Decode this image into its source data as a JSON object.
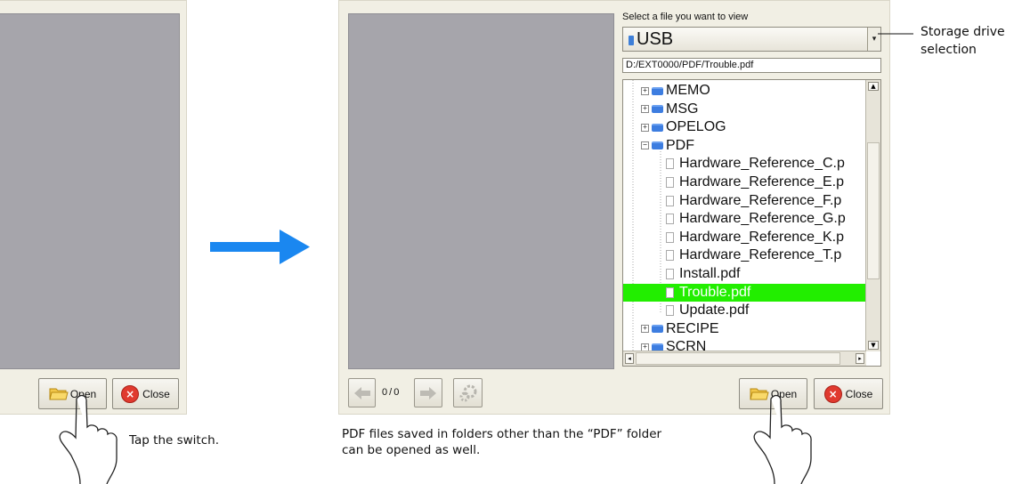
{
  "left_panel": {
    "open_label": "Open",
    "close_label": "Close",
    "caption": "Tap the switch."
  },
  "right_panel": {
    "heading": "Select a file you want to view",
    "drive": "USB",
    "path": "D:/EXT0000/PDF/Trouble.pdf",
    "page_counter": "0 / 0",
    "open_label": "Open",
    "close_label": "Close",
    "tree": [
      {
        "label": "MEMO",
        "kind": "folder",
        "depth": 0
      },
      {
        "label": "MSG",
        "kind": "folder",
        "depth": 0
      },
      {
        "label": "OPELOG",
        "kind": "folder",
        "depth": 0
      },
      {
        "label": "PDF",
        "kind": "folder-open",
        "depth": 0
      },
      {
        "label": "Hardware_Reference_C.p",
        "kind": "file",
        "depth": 1
      },
      {
        "label": "Hardware_Reference_E.p",
        "kind": "file",
        "depth": 1
      },
      {
        "label": "Hardware_Reference_F.p",
        "kind": "file",
        "depth": 1
      },
      {
        "label": "Hardware_Reference_G.p",
        "kind": "file",
        "depth": 1
      },
      {
        "label": "Hardware_Reference_K.p",
        "kind": "file",
        "depth": 1
      },
      {
        "label": "Hardware_Reference_T.p",
        "kind": "file",
        "depth": 1
      },
      {
        "label": "Install.pdf",
        "kind": "file",
        "depth": 1
      },
      {
        "label": "Trouble.pdf",
        "kind": "file",
        "depth": 1,
        "selected": true
      },
      {
        "label": "Update.pdf",
        "kind": "file",
        "depth": 1
      },
      {
        "label": "RECIPE",
        "kind": "folder",
        "depth": 0
      },
      {
        "label": "SCRN",
        "kind": "folder",
        "depth": 0
      }
    ],
    "caption_line1": "PDF files saved in folders other than the “PDF” folder",
    "caption_line2": "can be opened as well."
  },
  "callout": {
    "line1": "Storage drive",
    "line2": "selection"
  },
  "colors": {
    "selection": "#22ee00",
    "arrow": "#1a87f0",
    "screen_gray": "#a6a5ab",
    "panel": "#f1efe4"
  }
}
